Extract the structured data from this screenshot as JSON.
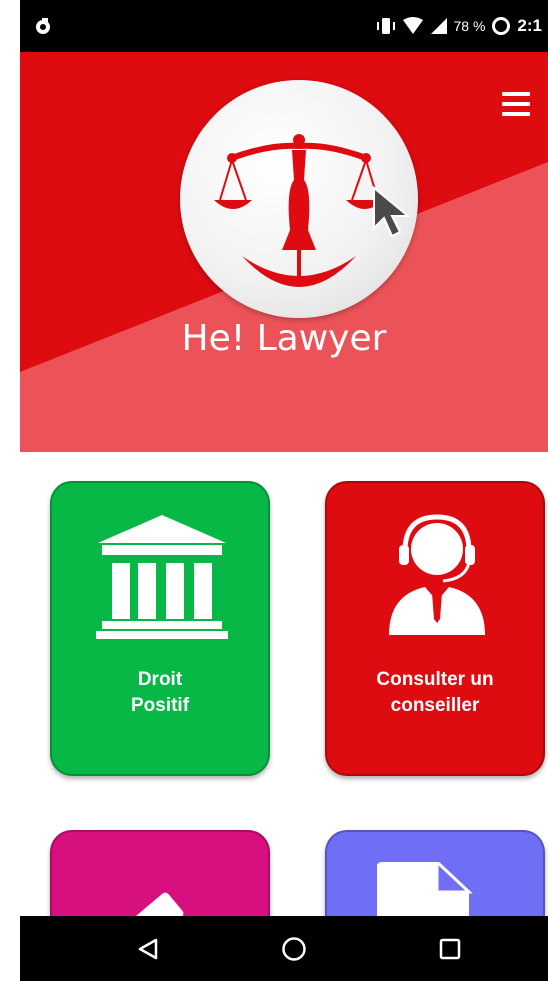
{
  "status_bar": {
    "battery": "78 %",
    "time": "2:1"
  },
  "header": {
    "app_title": "He! Lawyer",
    "logo": "scales-of-justice-logo",
    "menu_icon": "hamburger-menu-icon"
  },
  "tiles": [
    {
      "label": "Droit\nPositif",
      "icon": "courthouse-icon",
      "color": "#08b846"
    },
    {
      "label": "Consulter un\nconseiller",
      "icon": "advisor-headset-icon",
      "color": "#de0b10"
    },
    {
      "label": "",
      "icon": "gavel-icon",
      "color": "#d8107f"
    },
    {
      "label": "",
      "icon": "document-icon",
      "color": "#6f6ef5"
    }
  ],
  "nav_bar": {
    "back": "back-triangle-icon",
    "home": "home-circle-icon",
    "recents": "recents-square-icon"
  },
  "colors": {
    "header_red": "#de0b10",
    "header_light": "#ec5358",
    "status_bar": "#000000"
  }
}
